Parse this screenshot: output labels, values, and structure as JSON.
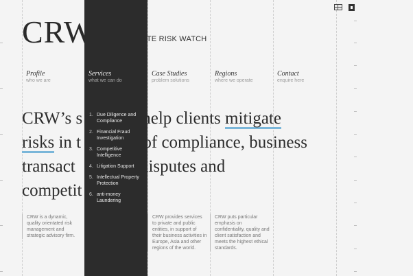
{
  "logo": "CRW",
  "tagline": "RATE RISK WATCH",
  "top_icons": [
    "flag-icon",
    "language-icon"
  ],
  "nav": [
    {
      "title": "Profile",
      "sub": "who we are"
    },
    {
      "title": "Services",
      "sub": "what we can do"
    },
    {
      "title": "Case Studies",
      "sub": "problem solutions"
    },
    {
      "title": "Regions",
      "sub": "where we operate"
    },
    {
      "title": "Contact",
      "sub": "enquire here"
    }
  ],
  "headline": {
    "p1": "CRW’s s",
    "p2": "help clients ",
    "p3": "mitigate",
    "p4": "risks",
    "p5": " in t",
    "p6": " of compliance, business",
    "p7": "transact",
    "p8": " disputes and",
    "p9": "competit"
  },
  "dropdown": [
    {
      "num": "1.",
      "label": "Due Diligence and Compliance"
    },
    {
      "num": "2.",
      "label": "Financial Fraud Investigation"
    },
    {
      "num": "3.",
      "label": "Competitive Intelligence"
    },
    {
      "num": "4.",
      "label": "Litigation Support"
    },
    {
      "num": "5.",
      "label": "Intellectual Property Protection"
    },
    {
      "num": "6.",
      "label": "anti-money Laundering"
    }
  ],
  "columns": [
    "CRW is a dynamic, quality orientated risk management and strategic advisory firm.",
    "CRW provides services to private and public entities, in support of their business activities in Europe, Asia and other regions of the world.",
    "CRW puts particular emphasis on confidentiality, quality and client satisfaction and meets the highest ethical standards."
  ]
}
